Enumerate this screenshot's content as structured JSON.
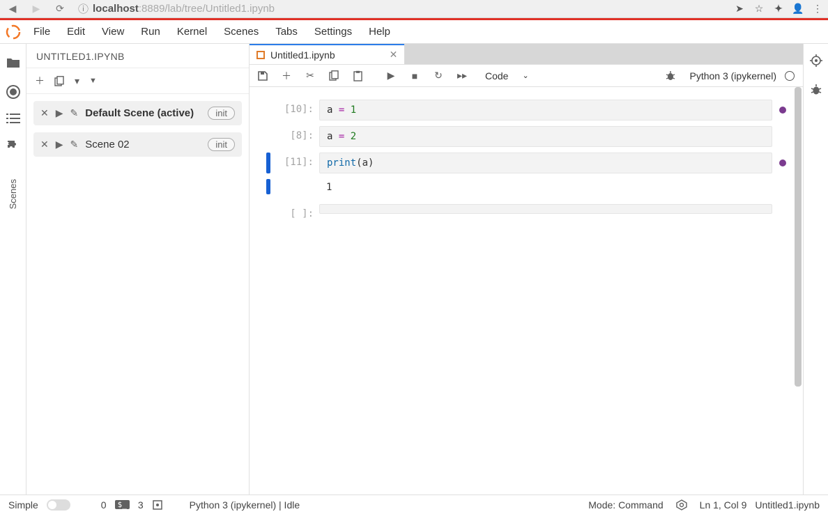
{
  "browser": {
    "url_prefix": "localhost",
    "url_rest": ":8889/lab/tree/Untitled1.ipynb"
  },
  "menu": {
    "items": [
      "File",
      "Edit",
      "View",
      "Run",
      "Kernel",
      "Scenes",
      "Tabs",
      "Settings",
      "Help"
    ]
  },
  "scenes_panel": {
    "title": "UNTITLED1.IPYNB",
    "items": [
      {
        "label": "Default Scene (active)",
        "active": true,
        "init": "init"
      },
      {
        "label": "Scene 02",
        "active": false,
        "init": "init"
      }
    ]
  },
  "left_rail_label": "Scenes",
  "tab": {
    "label": "Untitled1.ipynb"
  },
  "toolbar": {
    "cell_type": "Code",
    "kernel": "Python 3 (ipykernel)"
  },
  "cells": [
    {
      "prompt": "[10]:",
      "code_html": "<span class='tok-name'>a</span> <span class='tok-op'>=</span> <span class='tok-num'>1</span>",
      "dot": true
    },
    {
      "prompt": "[8]:",
      "code_html": "<span class='tok-name'>a</span> <span class='tok-op'>=</span> <span class='tok-num'>2</span>",
      "dot": false
    },
    {
      "prompt": "[11]:",
      "code_html": "<span class='tok-fn'>print</span>(a)",
      "dot": true,
      "focused": true,
      "output": "1"
    },
    {
      "prompt": "[ ]:",
      "code_html": "",
      "dot": false
    }
  ],
  "status": {
    "simple": "Simple",
    "alerts": "0",
    "terminals": "3",
    "kernel": "Python 3 (ipykernel) | Idle",
    "mode": "Mode: Command",
    "cursor": "Ln 1, Col 9",
    "file": "Untitled1.ipynb"
  }
}
